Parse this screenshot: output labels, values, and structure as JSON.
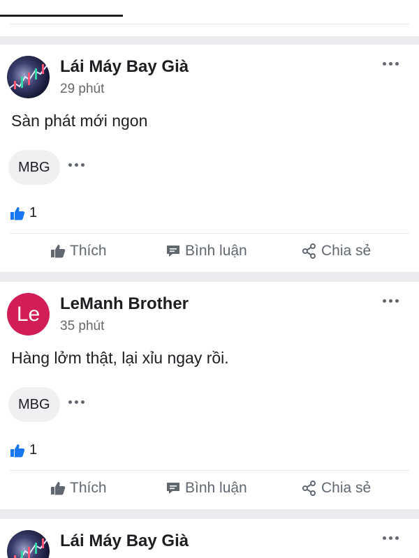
{
  "posts": [
    {
      "author": "Lái Máy Bay Già",
      "time": "29 phút",
      "text": "Sàn phát mới ngon",
      "avatar": "chart-avatar",
      "chip": "MBG",
      "like_count": "1"
    },
    {
      "author": "LeManh Brother",
      "time": "35 phút",
      "text": "Hàng lởm thật, lại xỉu ngay rồi.",
      "avatar_letter": "Le",
      "avatar_color": "#d21e57",
      "chip": "MBG",
      "like_count": "1"
    },
    {
      "author": "Lái Máy Bay Già",
      "avatar": "chart-avatar"
    }
  ],
  "actions": {
    "like": "Thích",
    "comment": "Bình luận",
    "share": "Chia sẻ"
  },
  "icons": {
    "like": "thumbs-up-icon",
    "comment": "comment-icon",
    "share": "share-icon",
    "more": "more-dots-icon"
  },
  "colors": {
    "accent": "#1877f2",
    "avatar_pink": "#d21e57"
  }
}
